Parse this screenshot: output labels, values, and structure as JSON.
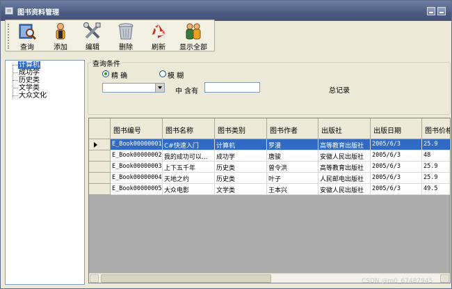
{
  "window": {
    "title": "图书资料管理"
  },
  "toolbar": {
    "buttons": [
      {
        "label": "查询",
        "icon": "book-search-icon"
      },
      {
        "label": "添加",
        "icon": "add-user-icon"
      },
      {
        "label": "编辑",
        "icon": "tools-icon"
      },
      {
        "label": "删除",
        "icon": "trash-icon"
      },
      {
        "label": "刷新",
        "icon": "recycle-icon"
      },
      {
        "label": "显示全部",
        "icon": "users-icon"
      }
    ]
  },
  "tree": {
    "items": [
      {
        "label": "计算机",
        "selected": true
      },
      {
        "label": "成功学"
      },
      {
        "label": "历史类"
      },
      {
        "label": "文学类"
      },
      {
        "label": "大众文化"
      }
    ]
  },
  "query": {
    "title": "查询条件",
    "radio_exact": "精 确",
    "radio_fuzzy": "模 糊",
    "contains_label": "中 含有",
    "total_label": "总记录",
    "combo_value": "",
    "text_value": ""
  },
  "grid": {
    "columns": [
      "图书编号",
      "图书名称",
      "图书类别",
      "图书作者",
      "出版社",
      "出版日期",
      "图书价格"
    ],
    "rows": [
      [
        "E_Book00000001",
        "C#快速入门",
        "计算机",
        "罗漫",
        "高等教育出版社",
        "2005/6/3",
        "25.9"
      ],
      [
        "E_Book00000002",
        "我的成功可以...",
        "成功学",
        "唐骏",
        "安徽人民出版社",
        "2005/6/3",
        "48"
      ],
      [
        "E_Book00000003",
        "上下五千年",
        "历史类",
        "曾令洪",
        "高等教育出版社",
        "2005/6/3",
        "25.9"
      ],
      [
        "E_Book00000004",
        "天地之约",
        "历史类",
        "叶子",
        "人民邮电出版社",
        "2005/6/3",
        "25.9"
      ],
      [
        "E_Book00000005",
        "大众电影",
        "文学类",
        "王本兴",
        "安徽人民出版社",
        "2005/6/3",
        "49.5"
      ]
    ],
    "selected_row": 0
  },
  "watermark": "CSDN @m0_67487945",
  "colors": {
    "title_bar": "#4c5b80",
    "selection": "#316ac5",
    "window_bg": "#ece9d8"
  }
}
